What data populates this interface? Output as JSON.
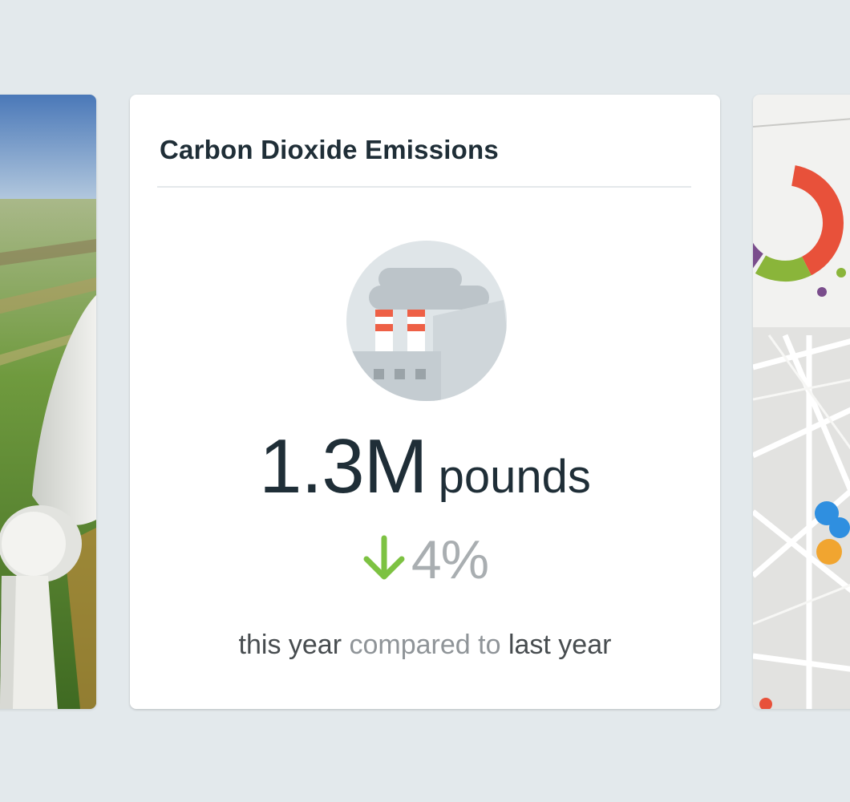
{
  "card": {
    "title": "Carbon Dioxide Emissions",
    "icon": "factory-icon",
    "metric": {
      "value": "1.3M",
      "unit": "pounds"
    },
    "change": {
      "direction": "down",
      "icon": "arrow-down-icon",
      "value": "4%"
    },
    "comparison": {
      "part1": "this year",
      "part2": "compared to",
      "part3": "last year"
    }
  },
  "colors": {
    "background": "#e3e9ec",
    "card": "#ffffff",
    "title": "#1f2e37",
    "arrow": "#7dc242",
    "muted": "#a9aeb1",
    "chimney_stripe": "#ee6046"
  },
  "side_cards": {
    "left": {
      "image": "wind-turbine-photo"
    },
    "right": {
      "image": "map-infographic-photo"
    }
  }
}
